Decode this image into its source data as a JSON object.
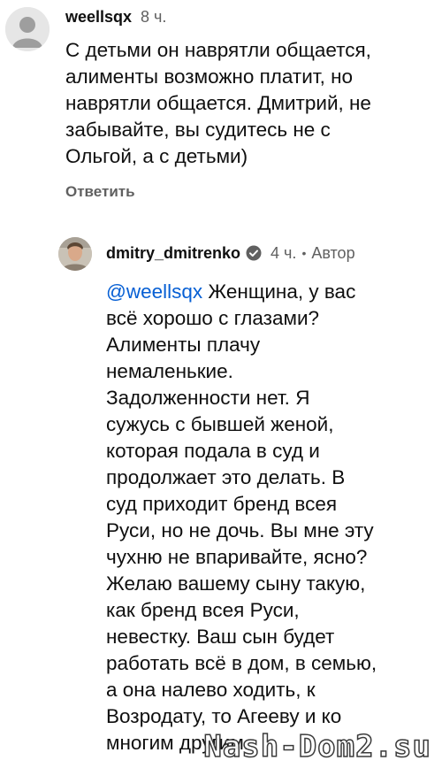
{
  "comments": [
    {
      "author": "weellsqx",
      "time": "8 ч.",
      "lines": [
        "С детьми он наврятли общается,",
        "алименты возможно платит, но",
        "наврятли общается. Дмитрий, не",
        "забывайте, вы судитесь не с",
        "Ольгой, а с детьми)"
      ],
      "reply_label": "Ответить",
      "avatar_icon": "person-icon"
    },
    {
      "author": "dmitry_dmitrenko",
      "verified_icon": "verified-checkmark-icon",
      "time": "4 ч.",
      "separator": "•",
      "role": "Автор",
      "mention": "@weellsqx",
      "first_line_rest": " Женщина, у вас",
      "lines": [
        "всё хорошо с глазами?",
        "Алименты плачу",
        "немаленькие.",
        "Задолженности нет. Я",
        "сужусь с бывшей женой,",
        "которая подала в суд и",
        "продолжает это делать. В",
        "суд приходит бренд всея",
        "Руси, но не дочь. Вы мне эту",
        "чухню не впаривайте, ясно?",
        "Желаю вашему сыну такую,",
        "как бренд всея Руси,",
        "невестку. Ваш сын будет",
        "работать всё в дом, в семью,",
        "а она налево ходить, к",
        "Возродату, то Агееву и ко",
        "многим другим."
      ],
      "avatar_icon": "profile-photo"
    }
  ],
  "watermark": "Nash-Dom2.su",
  "colors": {
    "mention": "#065fd4",
    "verified": "#606060",
    "secondary_text": "#606060",
    "primary_text": "#0f0f0f"
  }
}
